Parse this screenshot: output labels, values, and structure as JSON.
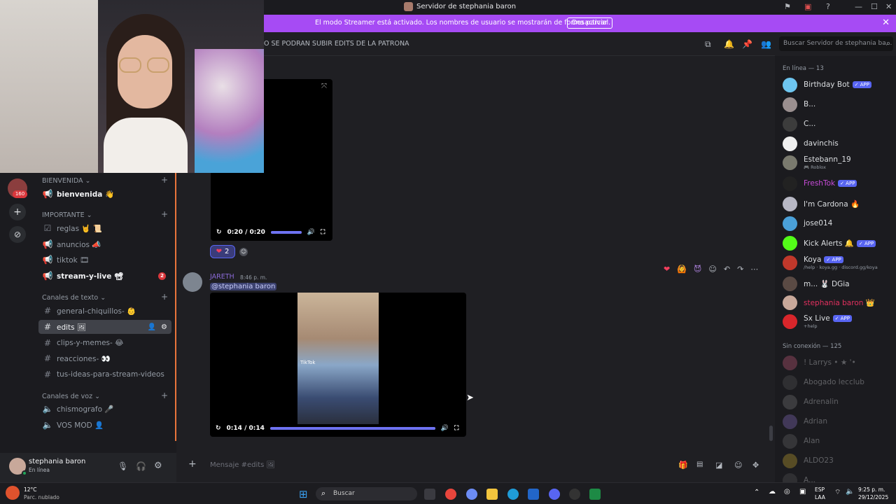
{
  "window": {
    "title": "Servidor de stephania baron"
  },
  "banner": {
    "text": "El modo Streamer está activado. Los nombres de usuario se mostrarán de forma parcial.",
    "button": "Desactivar"
  },
  "header": {
    "topic": "O SE PODRAN SUBIR EDITS DE LA PATRONA",
    "search_placeholder": "Buscar Servidor de stephania ba..."
  },
  "rail": {
    "badge": "160"
  },
  "sidebar": {
    "cat_bienvenida": "BIENVENIDA",
    "ch_bienvenida": "bienvenida 👋",
    "cat_importante": "IMPORTANTE",
    "ch_reglas": "reglas 🤘 📜",
    "ch_anuncios": "anuncios 📣",
    "ch_tiktok": "tiktok 🎞",
    "ch_stream": "stream-y-live 📽",
    "stream_badge": "2",
    "cat_texto": "Canales de texto",
    "ch_general": "general-chiquillos- 👶",
    "ch_edits": "edits 🖼",
    "ch_clips": "clips-y-memes- 😂",
    "ch_reacciones": "reacciones- 👀",
    "ch_ideas": "tus-ideas-para-stream-videos",
    "cat_voz": "Canales de voz",
    "ch_chismografo": "chismografo 🎤",
    "ch_vosmod": "VOS MOD 👤"
  },
  "user": {
    "name": "stephania baron",
    "status": "En línea"
  },
  "messages": {
    "video1_time": "0:20 / 0:20",
    "reaction_count": "2",
    "author": "JARETH",
    "timestamp": "8:46 p. m.",
    "mention": "@stephania baron",
    "tiktok_watermark": "TikTok",
    "video2_time": "0:14 / 0:14",
    "video1_progress": 1.0,
    "video2_progress": 1.0
  },
  "chat_input": {
    "placeholder": "Mensaje #edits 🖼"
  },
  "members": {
    "online_header": "En línea — 13",
    "offline_header": "Sin conexión — 125",
    "online": [
      {
        "name": "Birthday Bot",
        "app": "APP",
        "sub": "",
        "color": "#dbdee1",
        "avatar": "#6ec6f0"
      },
      {
        "name": "B...",
        "app": "",
        "sub": "",
        "color": "#dbdee1",
        "avatar": "#9a8f8f"
      },
      {
        "name": "C...",
        "app": "",
        "sub": "",
        "color": "#dbdee1",
        "avatar": "#3c3c3c"
      },
      {
        "name": "davinchis",
        "app": "",
        "sub": "",
        "color": "#dbdee1",
        "avatar": "#f0f0f0"
      },
      {
        "name": "Estebann_19",
        "app": "",
        "sub": "🎮 Roblox",
        "color": "#dbdee1",
        "avatar": "#7a7a6e"
      },
      {
        "name": "FreshTok",
        "app": "APP",
        "sub": "",
        "color": "#c74bd8",
        "avatar": "#222222"
      },
      {
        "name": "I'm Cardona 🔥",
        "app": "",
        "sub": "",
        "color": "#dbdee1",
        "avatar": "#b7b7c4"
      },
      {
        "name": "jose014",
        "app": "",
        "sub": "",
        "color": "#dbdee1",
        "avatar": "#4aa0d8"
      },
      {
        "name": "Kick Alerts 🔔",
        "app": "APP",
        "sub": "",
        "color": "#dbdee1",
        "avatar": "#53fc18"
      },
      {
        "name": "Koya",
        "app": "APP",
        "sub": "/help · koya.gg · discord.gg/koya",
        "color": "#dbdee1",
        "avatar": "#c0382b"
      },
      {
        "name": "m... 🐰 DGia",
        "app": "",
        "sub": "",
        "color": "#dbdee1",
        "avatar": "#5a4a44"
      },
      {
        "name": "stephania baron 👑",
        "app": "",
        "sub": "",
        "color": "#e2305f",
        "avatar": "#c8a89a"
      },
      {
        "name": "Sx Live",
        "app": "APP",
        "sub": "+help",
        "color": "#dbdee1",
        "avatar": "#d8262b"
      }
    ],
    "offline": [
      {
        "name": "! Larrys • ★ '•",
        "avatar": "#c85b7a"
      },
      {
        "name": "Abogado lecclub",
        "avatar": "#555555"
      },
      {
        "name": "Adrenalin",
        "avatar": "#777777"
      },
      {
        "name": "Adrian",
        "avatar": "#8a6fc2"
      },
      {
        "name": "Alan",
        "avatar": "#666666"
      },
      {
        "name": "ALDO23",
        "avatar": "#c8a832"
      },
      {
        "name": "A...",
        "avatar": "#555555"
      }
    ]
  },
  "taskbar": {
    "weather_temp": "12°C",
    "weather_desc": "Parc. nublado",
    "search": "Buscar",
    "lang1": "ESP",
    "lang2": "LAA",
    "time": "9:25 p. m.",
    "date": "29/12/2025"
  },
  "colors": {
    "accent": "#a64bf4",
    "brand": "#5865f2",
    "danger": "#da373c"
  }
}
